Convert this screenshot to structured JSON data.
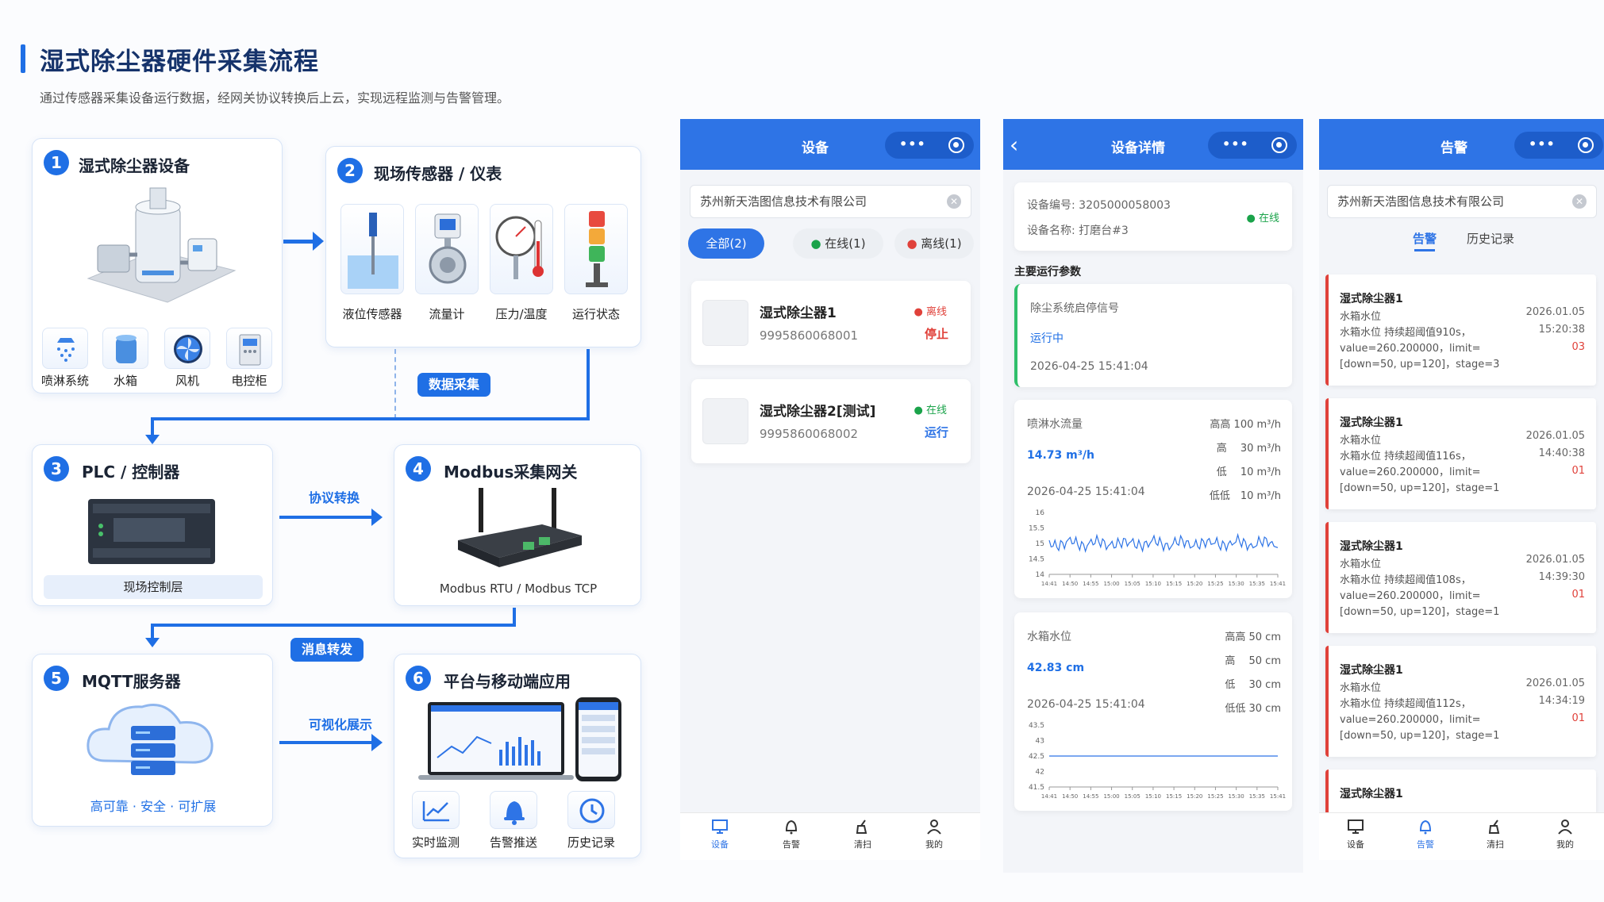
{
  "header": {
    "title": "湿式除尘器硬件采集流程",
    "subtitle": "通过传感器采集设备运行数据，经网关协议转换后上云，实现远程监测与告警管理。"
  },
  "diagram": {
    "steps": [
      {
        "num": "1",
        "title": "湿式除尘器设备",
        "subs": [
          "喷淋系统",
          "水箱",
          "风机",
          "电控柜"
        ]
      },
      {
        "num": "2",
        "title": "现场传感器 / 仪表",
        "subs": [
          "液位传感器",
          "流量计",
          "压力/温度",
          "运行状态"
        ]
      },
      {
        "num": "3",
        "title": "PLC / 控制器",
        "caption": "现场控制层"
      },
      {
        "num": "4",
        "title": "Modbus采集网关",
        "caption": "Modbus RTU / Modbus TCP"
      },
      {
        "num": "5",
        "title": "MQTT服务器",
        "caption": "高可靠 · 安全 · 可扩展"
      },
      {
        "num": "6",
        "title": "平台与移动端应用",
        "subs": [
          "实时监测",
          "告警推送",
          "历史记录"
        ]
      }
    ],
    "flow_labels": {
      "collect": "数据采集",
      "convert": "协议转换",
      "forward": "消息转发",
      "visual": "可视化展示"
    }
  },
  "phone_devices": {
    "title": "设备",
    "search": "苏州新天浩图信息技术有限公司",
    "filters": [
      "全部(2)",
      "在线(1)",
      "离线(1)"
    ],
    "devices": [
      {
        "name": "湿式除尘器1",
        "sn": "9995860068001",
        "online": "离线",
        "run": "停止"
      },
      {
        "name": "湿式除尘器2[测试]",
        "sn": "9995860068002",
        "online": "在线",
        "run": "运行"
      }
    ],
    "tabs": [
      "设备",
      "告警",
      "清扫",
      "我的"
    ]
  },
  "phone_detail": {
    "back": "‹",
    "title": "设备详情",
    "device_no": "设备编号: 3205000058003",
    "device_name": "设备名称: 打磨台#3",
    "status": "在线",
    "section": "主要运行参数",
    "signal": {
      "label": "除尘系统启停信号",
      "value": "运行中",
      "time": "2026-04-25 15:41:04"
    },
    "flow": {
      "label": "喷淋水流量",
      "value": "14.73 m³/h",
      "time": "2026-04-25 15:41:04",
      "thresholds": [
        "高高 100 m³/h",
        "高　 30 m³/h",
        "低　 10 m³/h",
        "低低　10 m³/h"
      ],
      "y_ticks": [
        "16",
        "15.5",
        "15",
        "14.5",
        "14"
      ]
    },
    "level": {
      "label": "水箱水位",
      "value": "42.83 cm",
      "time": "2026-04-25 15:41:04",
      "thresholds": [
        "高高 50 cm",
        "高　 50 cm",
        "低　 30 cm",
        "低低 30 cm"
      ],
      "y_ticks": [
        "43.5",
        "43",
        "42.5",
        "42",
        "41.5"
      ]
    },
    "x_ticks": [
      "14:41",
      "14:50",
      "14:55",
      "15:00",
      "15:05",
      "15:10",
      "15:15",
      "15:20",
      "15:25",
      "15:30",
      "15:35",
      "15:41"
    ]
  },
  "phone_alerts": {
    "title": "告警",
    "search": "苏州新天浩图信息技术有限公司",
    "tabs": [
      "告警",
      "历史记录"
    ],
    "alerts": [
      {
        "name": "湿式除尘器1",
        "item": "水箱水位",
        "desc": "水箱水位 持续超阈值910s，",
        "val": "value=260.200000，limit=",
        "range": "[down=50, up=120]，stage=3",
        "date": "2026.01.05",
        "time": "15:20:38",
        "count": "03"
      },
      {
        "name": "湿式除尘器1",
        "item": "水箱水位",
        "desc": "水箱水位 持续超阈值116s，",
        "val": "value=260.200000，limit=",
        "range": "[down=50, up=120]，stage=1",
        "date": "2026.01.05",
        "time": "14:40:38",
        "count": "01"
      },
      {
        "name": "湿式除尘器1",
        "item": "水箱水位",
        "desc": "水箱水位 持续超阈值108s，",
        "val": "value=260.200000，limit=",
        "range": "[down=50, up=120]，stage=1",
        "date": "2026.01.05",
        "time": "14:39:30",
        "count": "01"
      },
      {
        "name": "湿式除尘器1",
        "item": "水箱水位",
        "desc": "水箱水位 持续超阈值112s，",
        "val": "value=260.200000，limit=",
        "range": "[down=50, up=120]，stage=1",
        "date": "2026.01.05",
        "time": "14:34:19",
        "count": "01"
      },
      {
        "name": "湿式除尘器1"
      }
    ],
    "bottom_tabs": [
      "设备",
      "告警",
      "清扫",
      "我的"
    ]
  },
  "colors": {
    "primary": "#1f6fe5",
    "header": "#2e74e6",
    "online": "#1aa34a",
    "offline": "#e0413a"
  }
}
